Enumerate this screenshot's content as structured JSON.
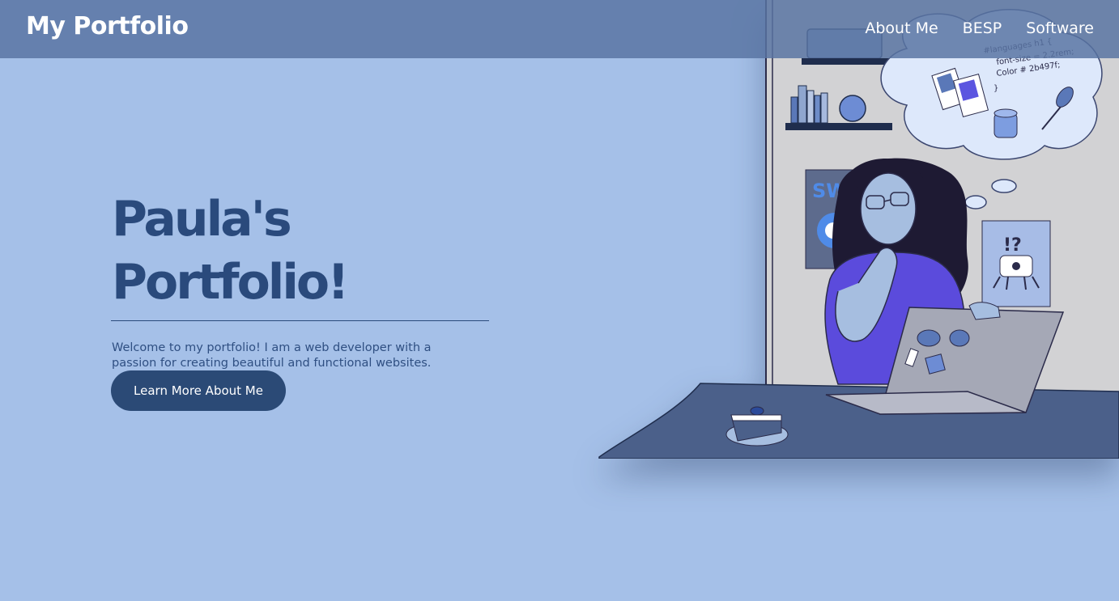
{
  "header": {
    "brand": "My Portfolio",
    "nav": [
      {
        "label": "About Me"
      },
      {
        "label": "BESP"
      },
      {
        "label": "Software"
      }
    ]
  },
  "hero": {
    "title_line1": "Paula's",
    "title_line2": "Portfolio!",
    "description": "Welcome to my portfolio! I am a web developer with a passion for creating beautiful and functional websites.",
    "cta_label": "Learn More About Me"
  },
  "illustration": {
    "thought_code": [
      "#languages h1 {",
      "font-size = 2.2rem;",
      "Color # 2b497f;",
      "}"
    ],
    "poster_left_text": "SW",
    "poster_right_text": "!?"
  },
  "colors": {
    "background": "#a5c0e8",
    "nav": "#5874a2",
    "title": "#2a4a7c",
    "button": "#2b4a76"
  }
}
